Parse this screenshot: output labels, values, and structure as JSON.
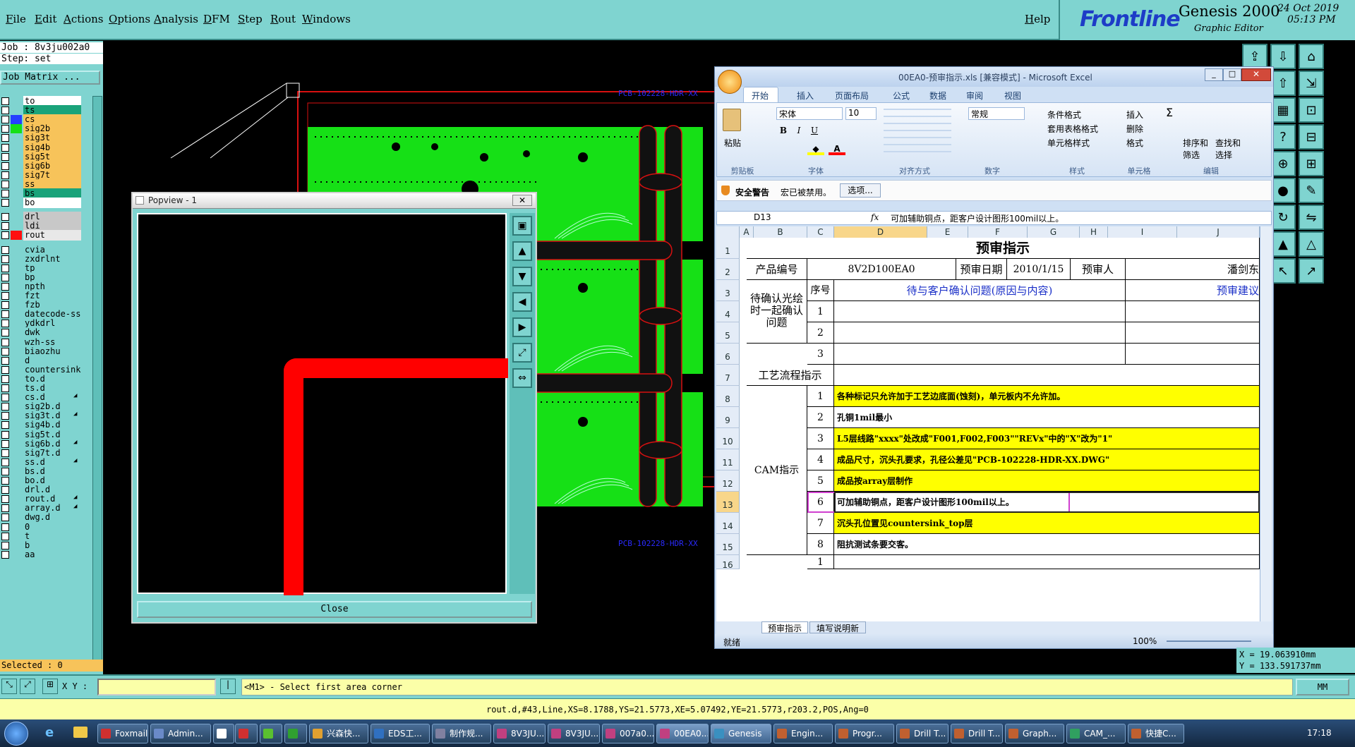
{
  "menu": {
    "items": [
      "File",
      "Edit",
      "Actions",
      "Options",
      "Analysis",
      "DFM",
      "Step",
      "Rout",
      "Windows"
    ],
    "help": "Help"
  },
  "brand": {
    "logo": "Frontline",
    "product": "Genesis 2000",
    "subtitle": "Graphic Editor",
    "date": "24 Oct 2019",
    "time": "05:13 PM"
  },
  "job": {
    "job_label": "Job : 8v3ju002a0",
    "step_label": "Step: set",
    "matrix_button": "Job Matrix ..."
  },
  "layers_board": [
    {
      "name": "to",
      "color": "#ffffff",
      "swatch": ""
    },
    {
      "name": "ts",
      "color": "#1aa37a",
      "swatch": ""
    },
    {
      "name": "cs",
      "color": "#f7c35a",
      "swatch": "#2540ff"
    },
    {
      "name": "sig2b",
      "color": "#f7c35a",
      "swatch": "#16e016"
    },
    {
      "name": "sig3t",
      "color": "#f7c35a",
      "swatch": ""
    },
    {
      "name": "sig4b",
      "color": "#f7c35a",
      "swatch": ""
    },
    {
      "name": "sig5t",
      "color": "#f7c35a",
      "swatch": ""
    },
    {
      "name": "sig6b",
      "color": "#f7c35a",
      "swatch": ""
    },
    {
      "name": "sig7t",
      "color": "#f7c35a",
      "swatch": ""
    },
    {
      "name": "ss",
      "color": "#f7c35a",
      "swatch": ""
    },
    {
      "name": "bs",
      "color": "#1aa37a",
      "swatch": ""
    },
    {
      "name": "bo",
      "color": "#ffffff",
      "swatch": ""
    }
  ],
  "layers_drill": [
    {
      "name": "drl",
      "color": "#c8c8c8",
      "swatch": ""
    },
    {
      "name": "ldi",
      "color": "#c8c8c8",
      "swatch": ""
    },
    {
      "name": "rout",
      "color": "#e8e8e8",
      "swatch": "#ff1010"
    }
  ],
  "layers_misc": [
    "cvia",
    "zxdrlnt",
    "tp",
    "bp",
    "npth",
    "fzt",
    "fzb",
    "datecode-ss",
    "ydkdrl",
    "dwk",
    "wzh-ss",
    "biaozhu",
    "d",
    "countersink",
    "to.d",
    "ts.d",
    "cs.d",
    "sig2b.d",
    "sig3t.d",
    "sig4b.d",
    "sig5t.d",
    "sig6b.d",
    "sig7t.d",
    "ss.d",
    "bs.d",
    "bo.d",
    "drl.d",
    "rout.d",
    "array.d",
    "dwg.d",
    "0",
    "t",
    "b",
    "aa"
  ],
  "selected": "Selected : 0",
  "popview": {
    "title": "Popview - 1",
    "close_button": "Close"
  },
  "pcb_labels": [
    "PCB-102228-HDR-XX",
    "PCB-102228-HDR-XX"
  ],
  "coords": {
    "x": "X = 19.063910mm",
    "y": "Y = 133.591737mm"
  },
  "command": {
    "xy_label": "X Y :",
    "prompt": "<M1> - Select first area corner",
    "units": "MM"
  },
  "status_line": "rout.d,#43,Line,XS=8.1788,YS=21.5773,XE=5.07492,YE=21.5773,r203.2,POS,Ang=0",
  "excel": {
    "title": "00EA0-预审指示.xls [兼容模式] - Microsoft Excel",
    "tabs": [
      "开始",
      "插入",
      "页面布局",
      "公式",
      "数据",
      "审阅",
      "视图"
    ],
    "font_name": "宋体",
    "font_size": "10",
    "number_format": "常规",
    "paste_label": "粘贴",
    "groups": [
      "剪贴板",
      "字体",
      "对齐方式",
      "数字",
      "样式",
      "单元格",
      "编辑"
    ],
    "styles": [
      "条件格式",
      "套用表格格式",
      "单元格样式"
    ],
    "cells_cmds": [
      "插入",
      "删除",
      "格式"
    ],
    "edit_cmds": [
      "排序和筛选",
      "查找和选择"
    ],
    "security_label": "安全警告",
    "security_text": "宏已被禁用。",
    "options_button": "选项...",
    "name_box": "D13",
    "formula": "可加辅助铜点，距客户设计图形100mil以上。",
    "col_headers": [
      "A",
      "B",
      "C",
      "D",
      "E",
      "F",
      "G",
      "H",
      "I",
      "J"
    ],
    "sheet": {
      "title": "预审指示",
      "product_no_label": "产品编号",
      "product_no": "8V2D100EA0",
      "date_label": "预审日期",
      "date": "2010/1/15",
      "reviewer_label": "预审人",
      "reviewer": "潘剑东",
      "confirm_label": "待确认光绘时一起确认问题",
      "seq_label": "序号",
      "question_header": "待与客户确认问题(原因与内容)",
      "advice_header": "预审建议",
      "confirm_rows": [
        "1",
        "2",
        "3"
      ],
      "process_label": "工艺流程指示",
      "cam_label": "CAM指示",
      "cam_items": [
        {
          "n": "1",
          "text": "各种标记只允许加于工艺边底面(蚀刻)，单元板内不允许加。",
          "hl": true
        },
        {
          "n": "2",
          "text": "孔铜1mil最小",
          "hl": false
        },
        {
          "n": "3",
          "text": "L5层线路\"xxxx\"处改成\"F001,F002,F003\"\"REVx\"中的\"X\"改为\"1\"",
          "hl": true
        },
        {
          "n": "4",
          "text": "成品尺寸，沉头孔要求，孔径公差见\"PCB-102228-HDR-XX.DWG\"",
          "hl": true
        },
        {
          "n": "5",
          "text": "成品按array层制作",
          "hl": true
        },
        {
          "n": "6",
          "text": "可加辅助铜点，距客户设计图形100mil以上。",
          "hl": false
        },
        {
          "n": "7",
          "text": "沉头孔位置见countersink_top层",
          "hl": true
        },
        {
          "n": "8",
          "text": "阻抗测试条要交客。",
          "hl": false
        },
        {
          "n": "1",
          "text": "",
          "hl": false
        }
      ],
      "row_numbers": [
        "1",
        "2",
        "3",
        "4",
        "5",
        "6",
        "7",
        "8",
        "9",
        "10",
        "11",
        "12",
        "13",
        "14",
        "15",
        "16"
      ]
    },
    "sheet_tabs": [
      "预审指示",
      "填写说明新"
    ],
    "status_ready": "就绪",
    "zoom": "100%"
  },
  "taskbar": {
    "items": [
      "Foxmail",
      "Admin...",
      "",
      "",
      "",
      "",
      "兴森快...",
      "EDS工...",
      "制作规...",
      "8V3JU...",
      "8V3JU...",
      "007a0...",
      "00EA0...",
      "Genesis",
      "Engin...",
      "Progr...",
      "Drill T...",
      "Drill T...",
      "Graph...",
      "CAM_...",
      "快捷C..."
    ],
    "clock": "17:18"
  }
}
